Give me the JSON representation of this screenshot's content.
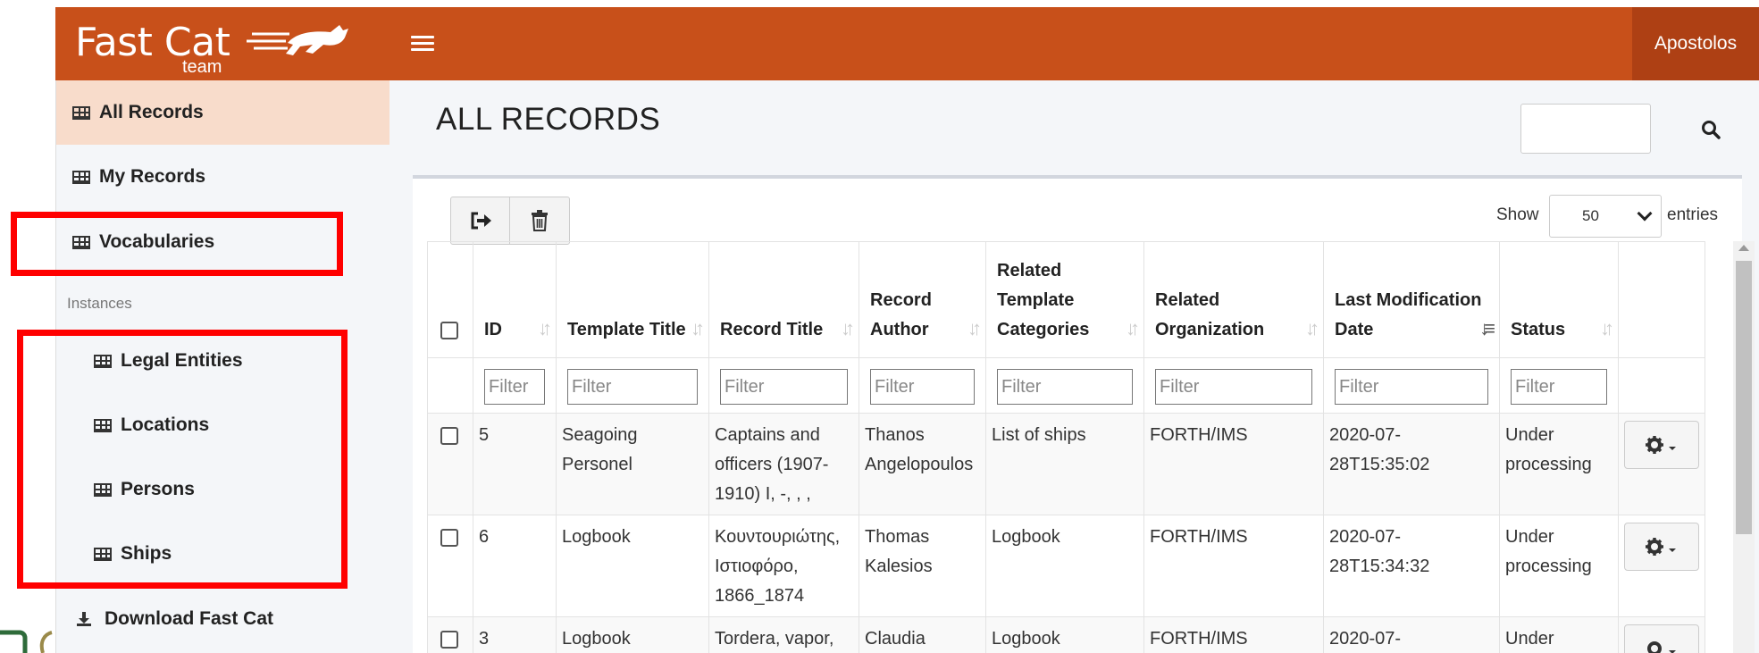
{
  "app": {
    "logo_text": "Fast Cat",
    "logo_sub": "team",
    "user": "Apostolos"
  },
  "sidebar": {
    "items": [
      {
        "label": "All Records"
      },
      {
        "label": "My Records"
      },
      {
        "label": "Vocabularies"
      }
    ],
    "section_label": "Instances",
    "instances": [
      {
        "label": "Legal Entities"
      },
      {
        "label": "Locations"
      },
      {
        "label": "Persons"
      },
      {
        "label": "Ships"
      }
    ],
    "download_label": "Download Fast Cat"
  },
  "main": {
    "title": "ALL RECORDS",
    "show_label": "Show",
    "entries_value": "50",
    "entries_label": "entries"
  },
  "table": {
    "headers": {
      "id": "ID",
      "template_title": "Template Title",
      "record_title": "Record Title",
      "record_author": "Record Author",
      "related_template_categories": "Related Template Categories",
      "related_organization": "Related Organization",
      "last_modification_date": "Last Modification Date",
      "status": "Status"
    },
    "filter_placeholder": "Filter",
    "rows": [
      {
        "id": "5",
        "template_title": "Seagoing Personel",
        "record_title": "Captains and officers (1907-1910) I, -, , ,",
        "record_author": "Thanos Angelopoulos",
        "categories": "List of ships",
        "organization": "FORTH/IMS",
        "date": "2020-07-28T15:35:02",
        "status": "Under processing"
      },
      {
        "id": "6",
        "template_title": "Logbook",
        "record_title": "Κουντουριώτης, Ιστιοφόρο, 1866_1874",
        "record_author": "Thomas Kalesios",
        "categories": "Logbook",
        "organization": "FORTH/IMS",
        "date": "2020-07-28T15:34:32",
        "status": "Under processing"
      },
      {
        "id": "3",
        "template_title": "Logbook",
        "record_title": "Tordera, vapor,",
        "record_author": "Claudia",
        "categories": "Logbook",
        "organization": "FORTH/IMS",
        "date": "2020-07-",
        "status": "Under"
      }
    ]
  }
}
